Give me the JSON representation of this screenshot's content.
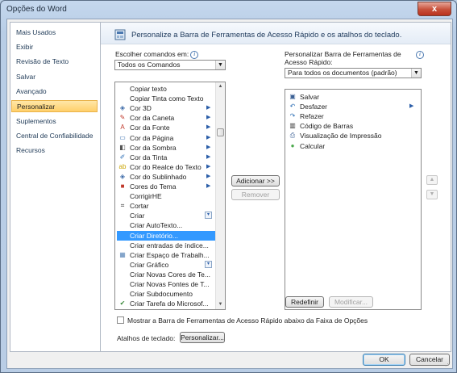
{
  "window": {
    "title": "Opções do Word",
    "close_glyph": "x"
  },
  "nav": {
    "items": [
      {
        "label": "Mais Usados"
      },
      {
        "label": "Exibir"
      },
      {
        "label": "Revisão de Texto"
      },
      {
        "label": "Salvar"
      },
      {
        "label": "Avançado"
      },
      {
        "label": "Personalizar",
        "selected": true
      },
      {
        "label": "Suplementos"
      },
      {
        "label": "Central de Confiabilidade"
      },
      {
        "label": "Recursos"
      }
    ]
  },
  "header": {
    "text": "Personalize a Barra de Ferramentas de Acesso Rápido e os atalhos do teclado."
  },
  "left": {
    "choose_label": "Escolher comandos em:",
    "info_glyph": "i",
    "choose_value": "Todos os Comandos",
    "commands": [
      {
        "label": "Copiar texto",
        "icon": "none"
      },
      {
        "label": "Copiar Tinta como Texto",
        "icon": "none"
      },
      {
        "label": "Cor 3D",
        "icon": "paint-bucket-icon",
        "submenu": true
      },
      {
        "label": "Cor da Caneta",
        "icon": "pen-icon",
        "submenu": true
      },
      {
        "label": "Cor da Fonte",
        "icon": "font-color-icon",
        "submenu": true
      },
      {
        "label": "Cor da Página",
        "icon": "page-color-icon",
        "submenu": true
      },
      {
        "label": "Cor da Sombra",
        "icon": "shadow-color-icon",
        "submenu": true
      },
      {
        "label": "Cor da Tinta",
        "icon": "ink-color-icon",
        "submenu": true
      },
      {
        "label": "Cor do Realce do Texto",
        "icon": "highlight-icon",
        "submenu": true
      },
      {
        "label": "Cor do Sublinhado",
        "icon": "underline-color-icon",
        "submenu": true
      },
      {
        "label": "Cores do Tema",
        "icon": "theme-colors-icon",
        "submenu": true
      },
      {
        "label": "CorrigirHE",
        "icon": "none"
      },
      {
        "label": "Cortar",
        "icon": "crop-icon"
      },
      {
        "label": "Criar",
        "icon": "none",
        "dropdown": true
      },
      {
        "label": "Criar AutoTexto...",
        "icon": "none"
      },
      {
        "label": "Criar Diretório...",
        "icon": "none",
        "selected": true
      },
      {
        "label": "Criar entradas de índice...",
        "icon": "none"
      },
      {
        "label": "Criar Espaço de Trabalh...",
        "icon": "workspace-icon"
      },
      {
        "label": "Criar Gráfico",
        "icon": "none",
        "dropdown": true
      },
      {
        "label": "Criar Novas Cores de Te...",
        "icon": "none"
      },
      {
        "label": "Criar Novas Fontes de T...",
        "icon": "none"
      },
      {
        "label": "Criar Subdocumento",
        "icon": "none"
      },
      {
        "label": "Criar Tarefa do Microsof...",
        "icon": "task-icon"
      }
    ]
  },
  "middle": {
    "add_button": "Adicionar >>",
    "remove_button": "Remover"
  },
  "right": {
    "customize_label": "Personalizar Barra de Ferramentas de Acesso Rápido:",
    "customize_value": "Para todos os documentos (padrão)",
    "items": [
      {
        "label": "Salvar",
        "icon": "save-icon"
      },
      {
        "label": "Desfazer",
        "icon": "undo-icon",
        "submenu": true
      },
      {
        "label": "Refazer",
        "icon": "redo-icon"
      },
      {
        "label": "Código de Barras",
        "icon": "barcode-icon"
      },
      {
        "label": "Visualização de Impressão",
        "icon": "print-preview-icon"
      },
      {
        "label": "Calcular",
        "icon": "calculate-icon"
      }
    ],
    "reset_button": "Redefinir",
    "modify_button": "Modificar..."
  },
  "footer": {
    "checkbox_label": "Mostrar a Barra de Ferramentas de Acesso Rápido abaixo da Faixa de Opções",
    "checkbox_checked": false,
    "shortcuts_label": "Atalhos de teclado:",
    "shortcuts_button": "Personalizar..."
  },
  "dialog": {
    "ok_button": "OK",
    "cancel_button": "Cancelar"
  },
  "colors": {
    "selection": "#3399ff",
    "nav_selected": "#ffd37a",
    "header_text": "#1e395b"
  }
}
